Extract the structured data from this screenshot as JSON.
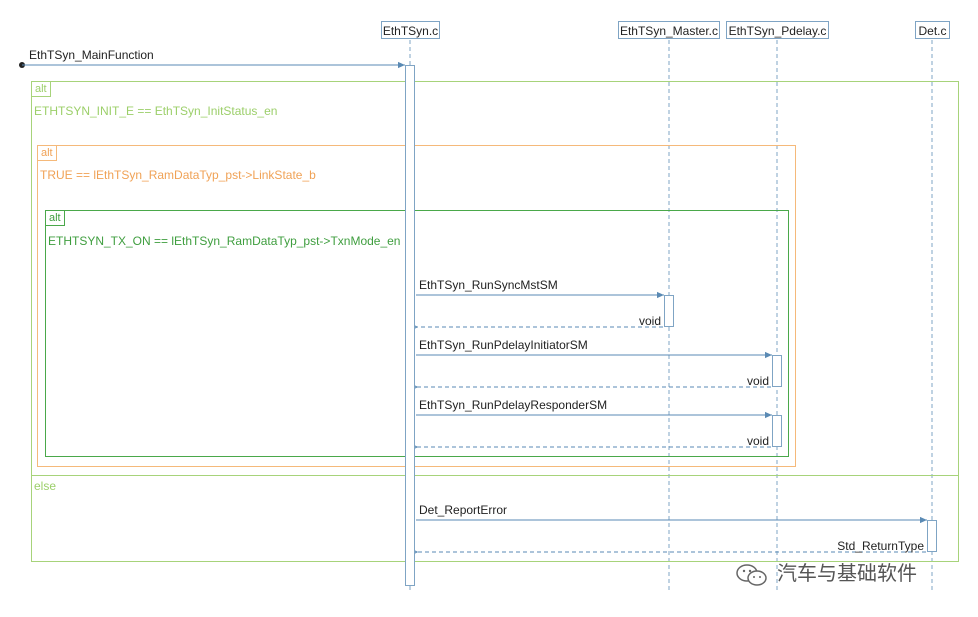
{
  "lifelines": [
    {
      "id": "ethtsyn",
      "label": "EthTSyn.c"
    },
    {
      "id": "master",
      "label": "EthTSyn_Master.c"
    },
    {
      "id": "pdelay",
      "label": "EthTSyn_Pdelay.c"
    },
    {
      "id": "det",
      "label": "Det.c"
    }
  ],
  "entry_message": {
    "label": "EthTSyn_MainFunction"
  },
  "fragments": {
    "outer": {
      "tag": "alt",
      "guard": "ETHTSYN_INIT_E == EthTSyn_InitStatus_en",
      "else_label": "else"
    },
    "middle": {
      "tag": "alt",
      "guard": "TRUE == lEthTSyn_RamDataTyp_pst->LinkState_b"
    },
    "inner": {
      "tag": "alt",
      "guard": "ETHTSYN_TX_ON == lEthTSyn_RamDataTyp_pst->TxnMode_en"
    }
  },
  "messages": [
    {
      "call": "EthTSyn_RunSyncMstSM",
      "return": "void"
    },
    {
      "call": "EthTSyn_RunPdelayInitiatorSM",
      "return": "void"
    },
    {
      "call": "EthTSyn_RunPdelayResponderSM",
      "return": "void"
    },
    {
      "call": "Det_ReportError",
      "return": "Std_ReturnType"
    }
  ],
  "watermark": {
    "text": "汽车与基础软件",
    "icon": "wechat-icon"
  },
  "colors": {
    "lifeline": "#7fa4c4",
    "arrow": "#5a8ab4",
    "outer_frag": "#a7d37a",
    "middle_frag": "#f5b97a",
    "inner_frag": "#4aa84a",
    "outer_text": "#9ccf6a",
    "middle_text": "#f0a256",
    "inner_text": "#3f9e3f"
  }
}
